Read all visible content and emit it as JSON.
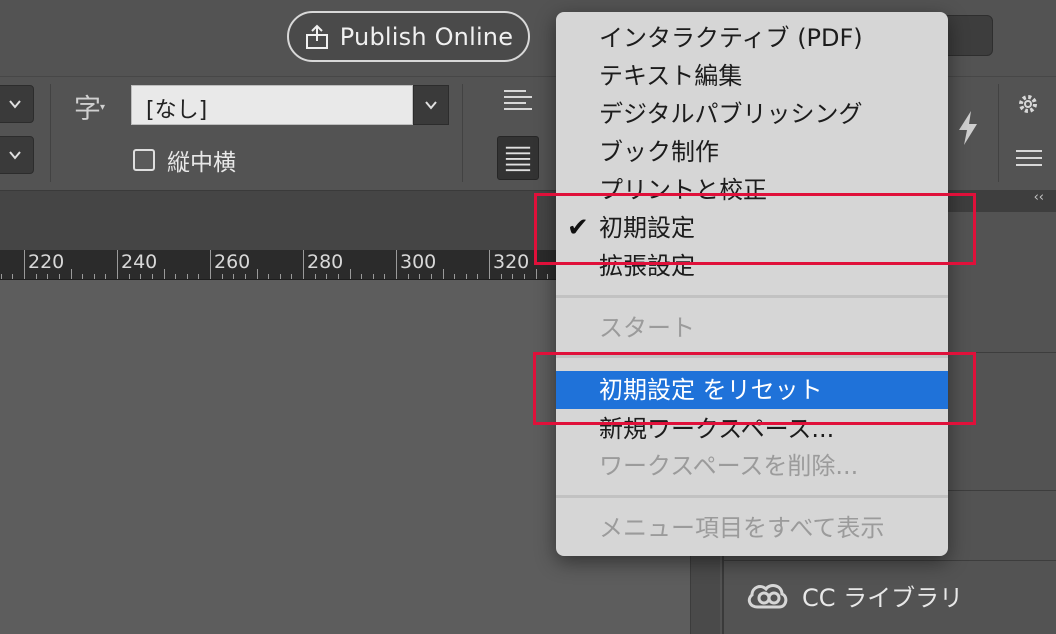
{
  "header": {
    "publish_label": "Publish Online"
  },
  "control_panel": {
    "font_field_value": "[なし]",
    "tcy_label": "縦中横",
    "char_icon": "字"
  },
  "ruler": {
    "labels": [
      "220",
      "240",
      "260",
      "280",
      "300",
      "320"
    ]
  },
  "right_panel": {
    "cc_libraries_label": "CC ライブラリ"
  },
  "workspace_menu": {
    "items": [
      {
        "label": "インタラクティブ (PDF)",
        "state": "normal"
      },
      {
        "label": "テキスト編集",
        "state": "normal"
      },
      {
        "label": "デジタルパブリッシング",
        "state": "normal"
      },
      {
        "label": "ブック制作",
        "state": "normal"
      },
      {
        "label": "プリントと校正",
        "state": "normal"
      },
      {
        "label": "初期設定",
        "state": "checked"
      },
      {
        "label": "拡張設定",
        "state": "normal"
      },
      {
        "label": "スタート",
        "state": "disabled"
      },
      {
        "label": "初期設定 をリセット",
        "state": "highlighted"
      },
      {
        "label": "新規ワークスペース...",
        "state": "normal"
      },
      {
        "label": "ワークスペースを削除...",
        "state": "disabled"
      },
      {
        "label": "メニュー項目をすべて表示",
        "state": "disabled"
      }
    ],
    "checkmark": "✔"
  },
  "colors": {
    "highlight": "#1f72d9",
    "annotation_red": "#e0103a",
    "menu_bg": "#d6d6d6",
    "app_bg": "#535353"
  }
}
